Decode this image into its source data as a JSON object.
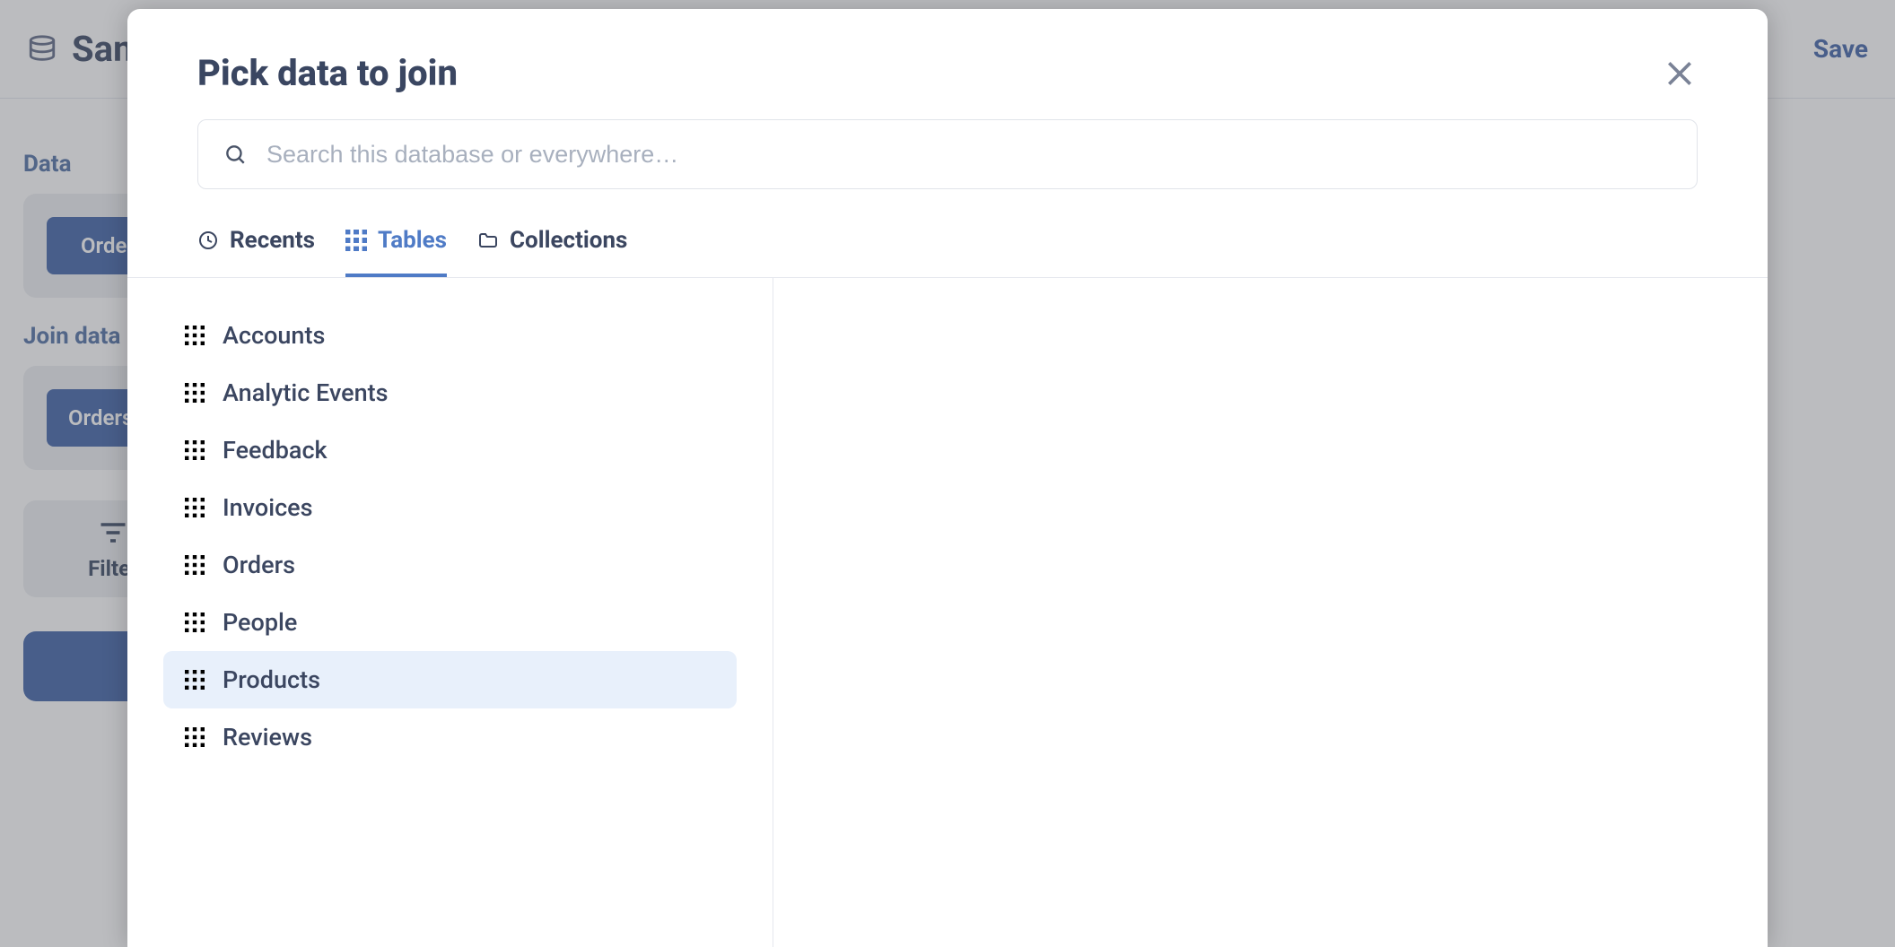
{
  "background": {
    "db_name": "Sample",
    "save_label": "Save",
    "sections": {
      "data_label": "Data",
      "data_pill": "Orders",
      "join_label": "Join data",
      "join_pill": "Orders",
      "filter_label": "Filter"
    }
  },
  "modal": {
    "title": "Pick data to join",
    "search_placeholder": "Search this database or everywhere…",
    "tabs": {
      "recents": "Recents",
      "tables": "Tables",
      "collections": "Collections"
    },
    "active_tab": "tables",
    "tables": [
      {
        "label": "Accounts",
        "highlight": false
      },
      {
        "label": "Analytic Events",
        "highlight": false
      },
      {
        "label": "Feedback",
        "highlight": false
      },
      {
        "label": "Invoices",
        "highlight": false
      },
      {
        "label": "Orders",
        "highlight": false
      },
      {
        "label": "People",
        "highlight": false
      },
      {
        "label": "Products",
        "highlight": true
      },
      {
        "label": "Reviews",
        "highlight": false
      }
    ]
  }
}
